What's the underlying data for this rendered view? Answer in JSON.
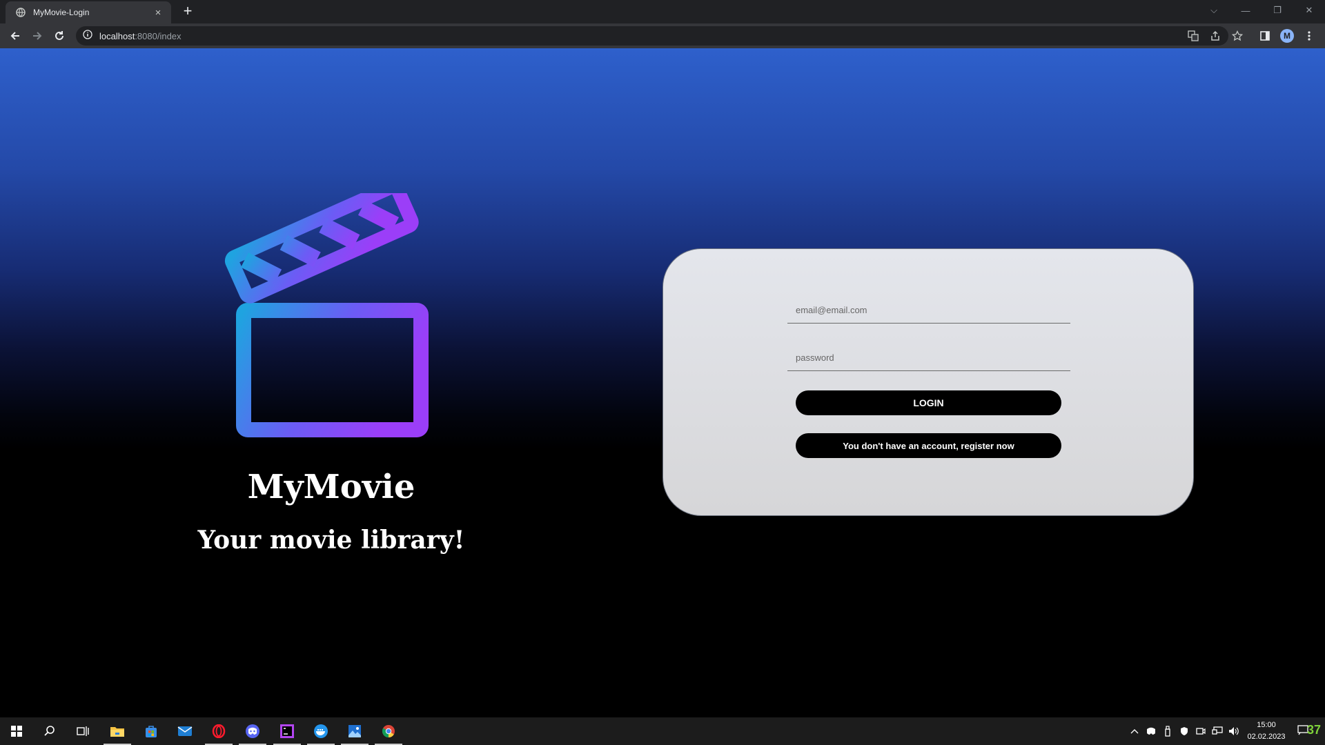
{
  "browser": {
    "tab_title": "MyMovie-Login",
    "tab_close": "×",
    "new_tab": "+",
    "url_host": "localhost",
    "url_rest": ":8080/index",
    "profile_initial": "M",
    "window_controls": {
      "collapse": "⌵",
      "minimize": "—",
      "restore": "❐",
      "close": "✕"
    }
  },
  "brand": {
    "title": "MyMovie",
    "subtitle": "Your movie library!",
    "logo_icon": "clapperboard-icon",
    "gradient_colors": [
      "#1fa3e0",
      "#6b5cf5",
      "#9b3ef8"
    ]
  },
  "login": {
    "email_placeholder": "email@email.com",
    "password_placeholder": "password",
    "login_label": "LOGIN",
    "register_label": "You don't have an account, register now"
  },
  "taskbar": {
    "time": "15:00",
    "date": "02.02.2023",
    "notification_count": "37",
    "apps": [
      "start-icon",
      "search-icon",
      "task-view-icon",
      "file-explorer-icon",
      "store-icon",
      "mail-icon",
      "opera-icon",
      "discord-icon",
      "phpstorm-icon",
      "docker-icon",
      "photos-icon",
      "chrome-icon"
    ]
  }
}
